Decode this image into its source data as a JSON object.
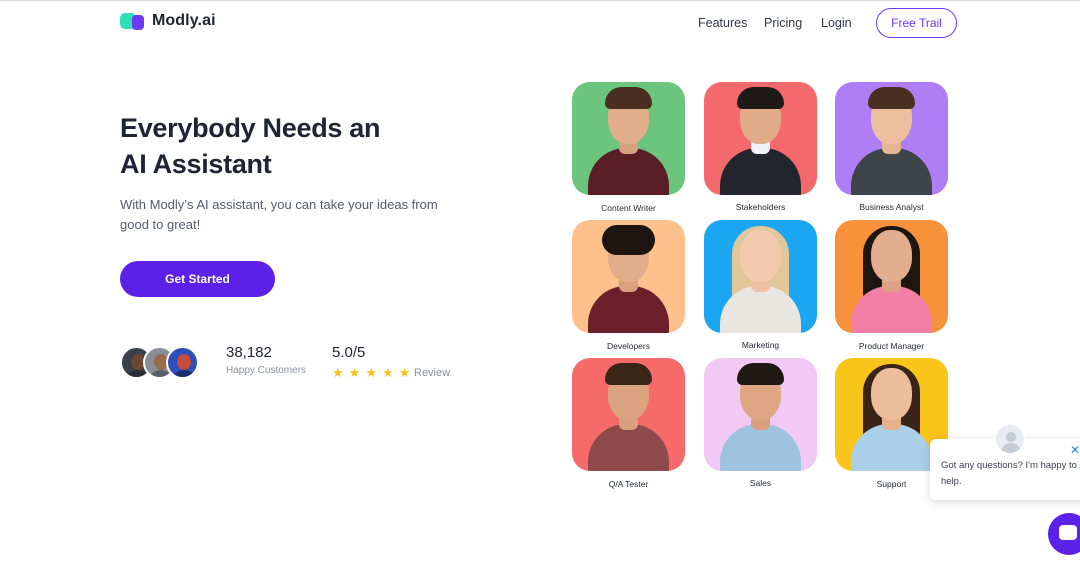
{
  "brand": {
    "name": "Modly.ai",
    "colors": {
      "primary": "#5b21e8",
      "teal": "#2ee0b3"
    }
  },
  "nav": {
    "features": "Features",
    "pricing": "Pricing",
    "login": "Login",
    "cta": "Free Trail"
  },
  "hero": {
    "title_line1": "Everybody Needs an",
    "title_line2": "AI Assistant",
    "subtitle": "With Modly’s AI assistant, you can take your ideas from good to great!",
    "cta": "Get Started"
  },
  "proof": {
    "customers_count": "38,182",
    "customers_label": "Happy Customers",
    "rating": "5.0/5",
    "stars": 5,
    "review_label": "Review"
  },
  "roles": [
    {
      "label": "Content Writer",
      "bg": "#6cc57c"
    },
    {
      "label": "Stakeholders",
      "bg": "#f4696b"
    },
    {
      "label": "Business Analyst",
      "bg": "#b07ef4"
    },
    {
      "label": "Developers",
      "bg": "#fec18c"
    },
    {
      "label": "Marketing",
      "bg": "#1aa6f0"
    },
    {
      "label": "Product Manager",
      "bg": "#f7913a"
    },
    {
      "label": "Q/A Tester",
      "bg": "#f66a6a"
    },
    {
      "label": "Sales",
      "bg": "#f2c8f5"
    },
    {
      "label": "Support",
      "bg": "#fac51b"
    }
  ],
  "chat": {
    "message": "Got any questions? I'm happy to help.",
    "close_icon": "close-icon",
    "launcher_icon": "chat-icon"
  }
}
